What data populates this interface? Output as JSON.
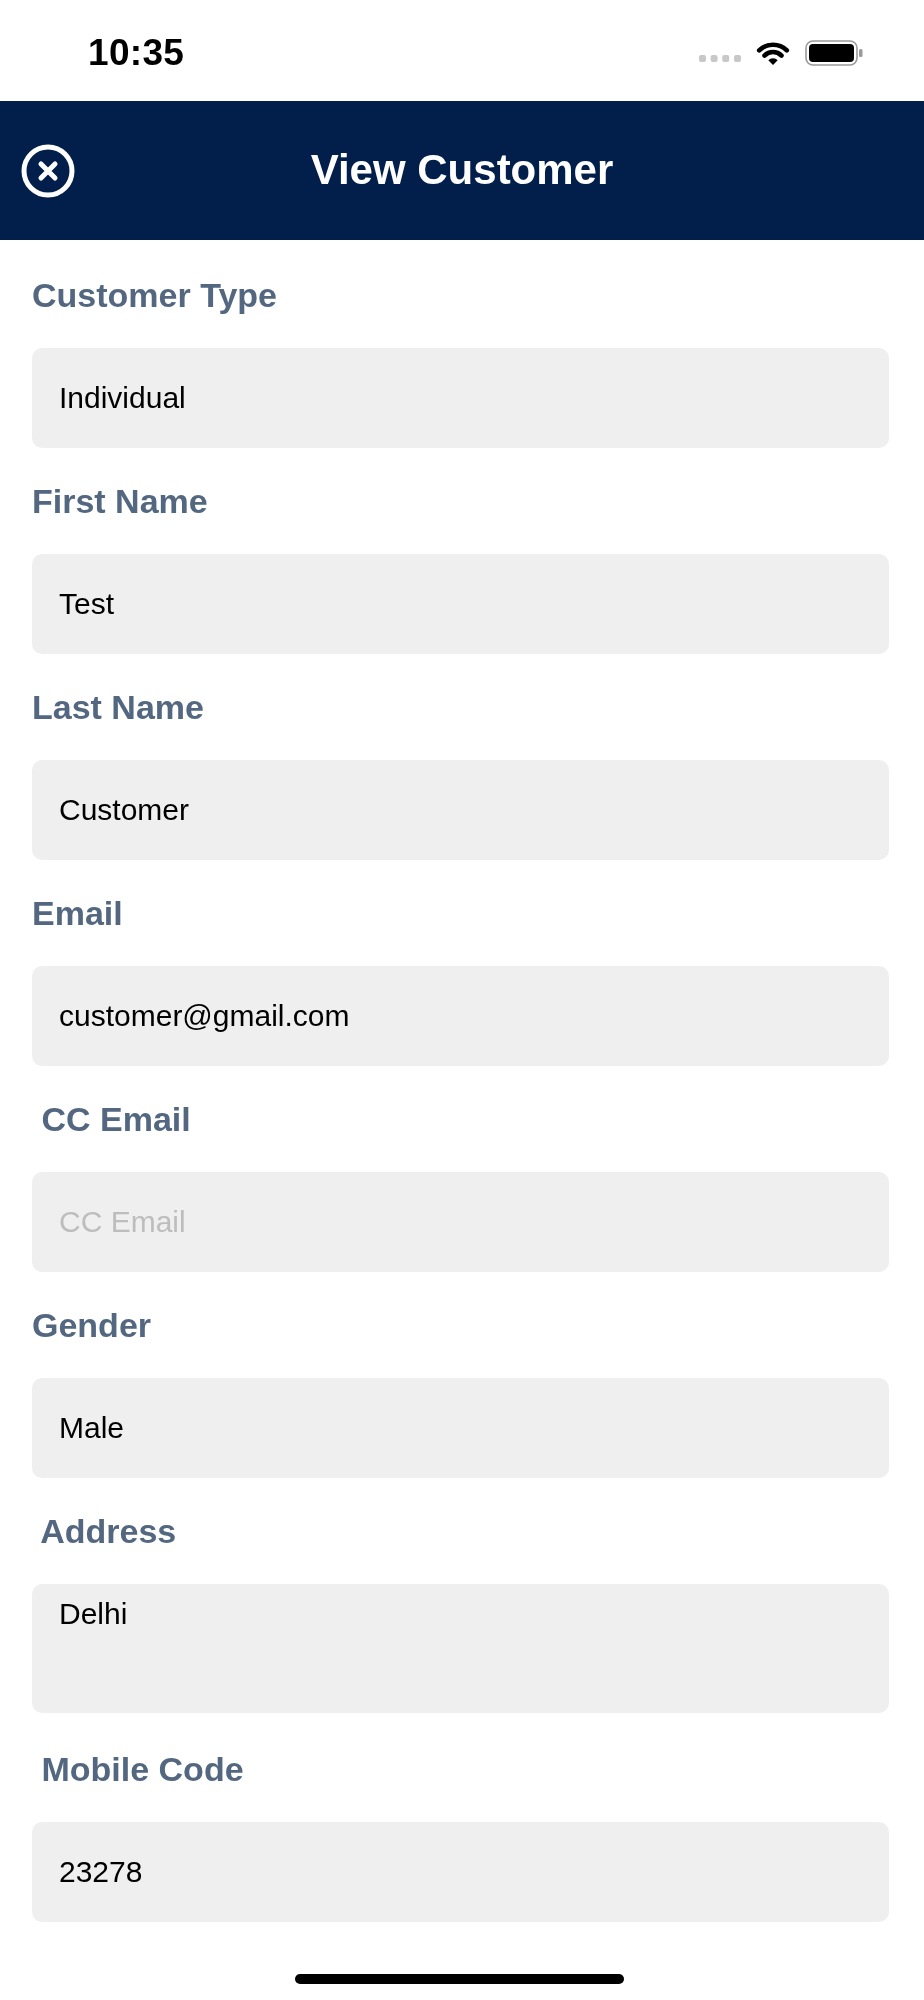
{
  "status_bar": {
    "time": "10:35"
  },
  "header": {
    "title": "View Customer"
  },
  "fields": [
    {
      "label": "Customer Type",
      "value": "Individual",
      "kind": "single_line"
    },
    {
      "label": "First Name",
      "value": "Test",
      "kind": "single_line"
    },
    {
      "label": "Last Name",
      "value": "Customer",
      "kind": "single_line"
    },
    {
      "label": "Email",
      "value": "customer@gmail.com",
      "kind": "single_line"
    },
    {
      "label": " CC Email",
      "placeholder": "CC Email",
      "kind": "single_line"
    },
    {
      "label": "Gender",
      "value": "Male",
      "kind": "single_line"
    },
    {
      "label": " Address",
      "value": "Delhi",
      "kind": "multiline"
    },
    {
      "label": " Mobile Code",
      "value": "23278",
      "kind": "single_line"
    }
  ]
}
